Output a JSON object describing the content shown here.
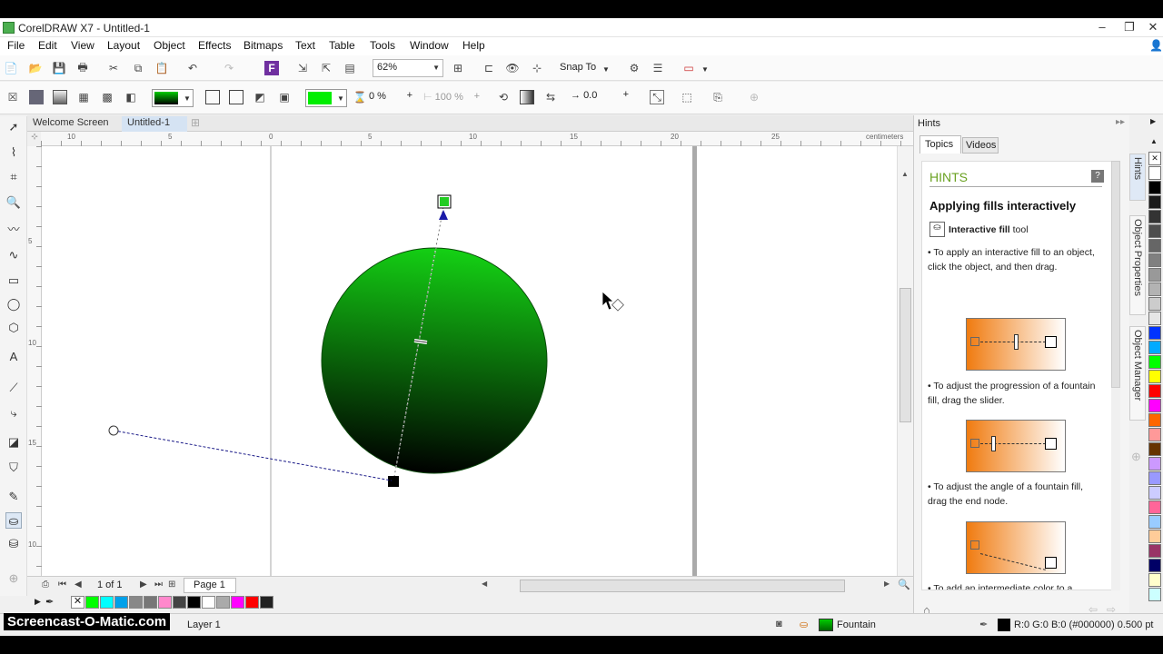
{
  "app": {
    "title": "CorelDRAW X7 - Untitled-1",
    "window_controls": [
      "–",
      "❐",
      "✕"
    ]
  },
  "menu": [
    "File",
    "Edit",
    "View",
    "Layout",
    "Object",
    "Effects",
    "Bitmaps",
    "Text",
    "Table",
    "Tools",
    "Window",
    "Help"
  ],
  "toolbar": {
    "zoom_value": "62%",
    "snap_to_label": "Snap To"
  },
  "property_bar": {
    "transparency_value": "0 %",
    "midpoint_value": "100 %",
    "angle_value": "0.0",
    "fill_color": "#00ee00",
    "fountain_preview_from": "#00cc00",
    "fountain_preview_to": "#000000"
  },
  "document_tabs": [
    "Welcome Screen",
    "Untitled-1"
  ],
  "ruler": {
    "unit": "centimeters",
    "h_ticks": [
      "10",
      "5",
      "0",
      "5",
      "10",
      "15",
      "20",
      "25"
    ],
    "v_ticks": [
      "5",
      "10",
      "15",
      "10"
    ]
  },
  "canvas": {
    "circle_color_top": "#14d114",
    "circle_color_bottom": "#000000",
    "end_node_color": "#22cc22"
  },
  "page_nav": {
    "page_count": "1 of 1",
    "page_tab": "Page 1"
  },
  "status": {
    "layer": "Layer 1",
    "fill_label": "Fountain",
    "outline_label": "R:0 G:0 B:0 (#000000)  0.500 pt"
  },
  "hints_docker": {
    "title": "Hints",
    "tabs": [
      "Topics",
      "Videos"
    ],
    "heading": "HINTS",
    "subheading": "Applying fills interactively",
    "tool_name": "Interactive fill",
    "tool_suffix": "tool",
    "step1": "• To apply an interactive fill to an object, click the object, and then drag.",
    "step2": "• To adjust the progression of a fountain fill, drag the slider.",
    "step3": "• To adjust the angle of a fountain fill, drag the end node.",
    "step4": "• To add an intermediate color to a"
  },
  "docker_tabs": [
    "Hints",
    "Object Properties",
    "Object Manager"
  ],
  "bottom_palette": [
    "#00ff00",
    "#00ffff",
    "#00a0e9",
    "#888888",
    "#777777",
    "#ff88cc",
    "#444444",
    "#000000",
    "#ffffff",
    "#aaaaaa",
    "#ff00ff",
    "#ff0000",
    "#222222"
  ],
  "right_palette": [
    "#ffffff",
    "#000000",
    "#1a1a1a",
    "#333333",
    "#4d4d4d",
    "#666666",
    "#808080",
    "#999999",
    "#b3b3b3",
    "#cccccc",
    "#e6e6e6",
    "#0033ff",
    "#00aaff",
    "#00ff00",
    "#ffff00",
    "#ff0000",
    "#ff00ff",
    "#ff6600",
    "#ff9999",
    "#663300",
    "#cc99ff",
    "#9999ff",
    "#ccccff",
    "#ff6699",
    "#99ccff",
    "#ffcc99",
    "#993366",
    "#000066",
    "#ffffcc",
    "#ccffff"
  ],
  "watermark": "Screencast-O-Matic.com"
}
